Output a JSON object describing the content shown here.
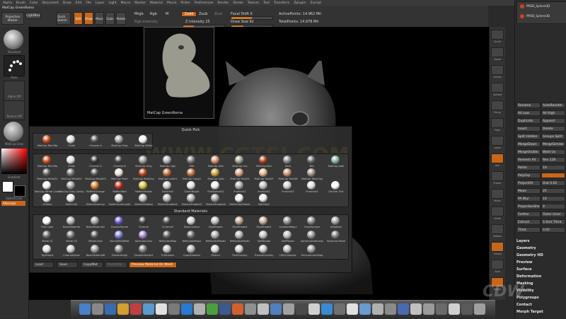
{
  "menu": [
    "Alpha",
    "Brush",
    "Color",
    "Document",
    "Draw",
    "Edit",
    "File",
    "Layer",
    "Light",
    "Macro",
    "Marker",
    "Material",
    "Movie",
    "Picker",
    "Preferences",
    "Render",
    "Stroke",
    "Texture",
    "Tool",
    "Transform",
    "Zplugin",
    "Zscript"
  ],
  "toolbar": {
    "matcap_name": "MatCap GreenRoma",
    "projection_master": "Projection Master",
    "lightbox": "LightBox",
    "quick_sketch": "Quick Sketch",
    "edit": "Edit",
    "draw": "Draw",
    "move": "Move",
    "scale": "Scale",
    "rotate": "Rotate",
    "mrgb": "Mrgb",
    "rgb": "Rgb",
    "m": "M",
    "rgb_intensity": "Rgb Intensity",
    "zadd": "Zadd",
    "zsub": "Zsub",
    "zcut": "Zcut",
    "z_intensity": "Z Intensity 25",
    "focal_shift": "Focal Shift 0",
    "draw_size": "Draw Size 92",
    "active_points": "ActivePoints: 14.962 Mil",
    "total_points": "TotalPoints: 14.978 Mil",
    "colors": {
      "accent": "#d07a20",
      "bg": "#333333"
    }
  },
  "left_shelf": {
    "labels": [
      "Standard",
      "Dots",
      "Alpha Off",
      "Texture Off",
      "MatCap Gray",
      "Gradient",
      "SwitchColor",
      "Alternate"
    ]
  },
  "preview_label": "MatCap GreenRoma",
  "popup": {
    "quick_pick_title": "Quick Pick",
    "quick_pick": [
      {
        "name": "MatCap Red Wa",
        "color": "#c8501e"
      },
      {
        "name": "Chalk",
        "color": "#dcdcdc"
      },
      {
        "name": "Chrome A",
        "color": "#555555"
      },
      {
        "name": "MatCap Gray",
        "color": "#a0a0a0"
      },
      {
        "name": "MatCap White",
        "color": "#f0f0f0"
      }
    ],
    "matcap_row1": [
      {
        "name": "MatCap Red Wa",
        "color": "#c8501e"
      },
      {
        "name": "Chalk",
        "color": "#e0e0e0"
      },
      {
        "name": "Chrome A",
        "color": "#3a3a3a"
      },
      {
        "name": "Chrome B",
        "color": "#4a4a4a"
      },
      {
        "name": "MatCap Gray",
        "color": "#9a9a9a"
      },
      {
        "name": "MatCap Ligh",
        "color": "#b0b0b0"
      },
      {
        "name": "Met",
        "color": "#777777"
      },
      {
        "name": "MatCap Skin",
        "color": "#d09070"
      },
      {
        "name": "MatCap Gre",
        "color": "#9aa08a"
      },
      {
        "name": "MatCap Red",
        "color": "#b04020"
      },
      {
        "name": "Hard",
        "color": "#888888"
      },
      {
        "name": "Blin",
        "color": "#666666"
      },
      {
        "name": "MatCap Jade",
        "color": "#8ab098"
      }
    ],
    "matcap_row2": [
      {
        "name": "MatCap Metal01",
        "color": "#606060"
      },
      {
        "name": "MatCap Metal02",
        "color": "#707070"
      },
      {
        "name": "MatCap Metal03",
        "color": "#555555"
      },
      {
        "name": "MatCap Pearl",
        "color": "#e8e0d8"
      },
      {
        "name": "MatCap RedClay",
        "color": "#b8461e"
      },
      {
        "name": "MatCap Lobi01",
        "color": "#c06a40"
      },
      {
        "name": "MatCap Copp1",
        "color": "#b87040"
      },
      {
        "name": "MatCap Gold",
        "color": "#c8a040"
      },
      {
        "name": "MatCap Skin04",
        "color": "#d8a080"
      },
      {
        "name": "MatCap Skin05",
        "color": "#e0b090"
      },
      {
        "name": "MatCap Skin06",
        "color": "#c89070"
      },
      {
        "name": "MatCap WaxClay",
        "color": "#a09080"
      }
    ],
    "matcap_row3": [
      {
        "name": "MatCap White Cavity",
        "color": "#f2f2f2"
      },
      {
        "name": "MatCap Gray Cavity",
        "color": "#9c9c9c"
      },
      {
        "name": "ReflectOrange",
        "color": "#d08030"
      },
      {
        "name": "ReflectRed",
        "color": "#c03020"
      },
      {
        "name": "ReflectYellow",
        "color": "#d0c040"
      },
      {
        "name": "SilverFoil",
        "color": "#c8c8c8"
      },
      {
        "name": "SilverBright",
        "color": "#e0e0e0"
      },
      {
        "name": "FlatSketch01",
        "color": "#eeeeee"
      },
      {
        "name": "Framer01",
        "color": "#aaaaaa"
      },
      {
        "name": "Framer02",
        "color": "#bbbbbb"
      },
      {
        "name": "Framer03",
        "color": "#cccccc"
      },
      {
        "name": "Framer04",
        "color": "#dddddd"
      },
      {
        "name": "Outline Thic",
        "color": "#ffffff"
      }
    ],
    "matcap_row4": [
      {
        "name": "Outline",
        "color": "#ffffff"
      },
      {
        "name": "Sketch04",
        "color": "#e6e6e6"
      },
      {
        "name": "SketchGummy",
        "color": "#d8d8d8"
      },
      {
        "name": "SketchGummySh",
        "color": "#cfcfcf"
      },
      {
        "name": "SketchShaded",
        "color": "#bfbfbf"
      },
      {
        "name": "SketchShaded2",
        "color": "#b5b5b5"
      },
      {
        "name": "SketchShaded3",
        "color": "#ababab"
      },
      {
        "name": "SketchShaded4",
        "color": "#a0a0a0"
      },
      {
        "name": "SketchToyPlastic",
        "color": "#f0f0f0"
      },
      {
        "name": "MatCap2",
        "color": "#eaeaea"
      }
    ],
    "standard_title": "Standard Materials",
    "standard_row1": [
      {
        "name": "Flat Color",
        "color": "#ffffff"
      },
      {
        "name": "BasicMaterial",
        "color": "#b0b0b0"
      },
      {
        "name": "BasicMaterial2",
        "color": "#a0a0a0"
      },
      {
        "name": "DoubleShade",
        "color": "#6a5acd"
      },
      {
        "name": "Chrome",
        "color": "#444444"
      },
      {
        "name": "Chrome2",
        "color": "#505050"
      },
      {
        "name": "DotsContour",
        "color": "#d0d0d0"
      },
      {
        "name": "FastShader",
        "color": "#bcbcbc"
      },
      {
        "name": "SkinShade4",
        "color": "#c0a090"
      },
      {
        "name": "SkinShade4",
        "color": "#c8a898"
      },
      {
        "name": "GradientMap2",
        "color": "#909090"
      },
      {
        "name": "GrayHorizon",
        "color": "#888888"
      },
      {
        "name": "JellyBean",
        "color": "#a0a0a0"
      }
    ],
    "standard_row2": [
      {
        "name": "Metal 01",
        "color": "#6a6a6a"
      },
      {
        "name": "Metal 03",
        "color": "#747474"
      },
      {
        "name": "MetalCrisis",
        "color": "#5a5a5a"
      },
      {
        "name": "NormalRGBMat",
        "color": "#7a7ad0"
      },
      {
        "name": "NormalsColor",
        "color": "#a080d0"
      },
      {
        "name": "ReflectedMap",
        "color": "#606060"
      },
      {
        "name": "ReflectedMap2",
        "color": "#686868"
      },
      {
        "name": "ReflectedPlastic",
        "color": "#a8a8a8"
      },
      {
        "name": "ReflectedPlastic",
        "color": "#b0b0b0"
      },
      {
        "name": "SoftShade",
        "color": "#c0c0c0"
      },
      {
        "name": "SoftPlastic",
        "color": "#b8b8b8"
      },
      {
        "name": "SphericalIntensity",
        "color": "#909090"
      },
      {
        "name": "Textured Metal",
        "color": "#7a7a7a"
      }
    ],
    "standard_row3": [
      {
        "name": "ToyPlastic",
        "color": "#e0e0e0"
      },
      {
        "name": "ColorizeGlow",
        "color": "#c8c8c8"
      },
      {
        "name": "BasicMaterialB",
        "color": "#9c9c9c"
      },
      {
        "name": "DarkenEdge",
        "color": "#8c8c8c"
      },
      {
        "name": "DoubleShade3",
        "color": "#7c7c7c"
      },
      {
        "name": "TriShaders",
        "color": "#bdbdbd"
      },
      {
        "name": "QuadShaders",
        "color": "#b2b2b2"
      },
      {
        "name": "Fibers1",
        "color": "#d4d4d4"
      },
      {
        "name": "FastOverlay",
        "color": "#cccccc"
      },
      {
        "name": "FresnelOverlay",
        "color": "#c2c2c2"
      },
      {
        "name": "HDVColorizer",
        "color": "#b8b8b8"
      },
      {
        "name": "EnvironmentMap",
        "color": "#9a9a9a"
      }
    ],
    "footer": {
      "load": "Load",
      "save": "Save",
      "copymat": "CopyMat",
      "pastemat": "PasteMat",
      "preview": "Preview Material On Mesh"
    }
  },
  "watermark": "WWW.CGTSJ.COM",
  "right_tools": [
    "Scroll",
    "Zoom",
    "Actual",
    "AAHalf",
    "Persp",
    "Floor",
    "Local",
    "Xyz",
    "Frame",
    "Move",
    "Scale",
    "Rotate",
    "Transp",
    "Solo",
    "Xpose"
  ],
  "palette": {
    "subtools": [
      "PM3D_Sphere3D",
      "PM3D_Sphere3D"
    ],
    "rows": [
      {
        "label": "Rename",
        "value": "AutoReorder"
      },
      {
        "label": "All Low",
        "value": "All High"
      },
      {
        "label": "Duplicate",
        "value": "Append"
      },
      {
        "label": "Insert",
        "value": "Delete"
      },
      {
        "label": "Split Hidden",
        "value": "Groups Split"
      },
      {
        "label": "MergeDown",
        "value": "MergeSimilar"
      },
      {
        "label": "MergeVisible",
        "value": "Weld  Uv"
      },
      {
        "label": "Remesh All",
        "value": "Res 128"
      },
      {
        "label": "Polish",
        "value": "10"
      },
      {
        "label": "PolyGrp",
        "value": ""
      },
      {
        "label": "ProjectAll",
        "value": "Dist 0.02"
      },
      {
        "label": "Mean",
        "value": "25"
      },
      {
        "label": "PA Blur",
        "value": "10"
      },
      {
        "label": "ProjectionShell",
        "value": "0"
      },
      {
        "label": "Farther",
        "value": "Outer  Inner"
      },
      {
        "label": "Extract",
        "value": "S Smt  TSmt"
      },
      {
        "label": "Thick",
        "value": "0.02"
      }
    ],
    "sections": [
      "Layers",
      "Geometry",
      "Geometry HD",
      "Preview",
      "Surface",
      "Deformation",
      "Masking",
      "Visibility",
      "Polygroups",
      "Contact",
      "Morph Target"
    ]
  },
  "dock_logo": "CDW"
}
